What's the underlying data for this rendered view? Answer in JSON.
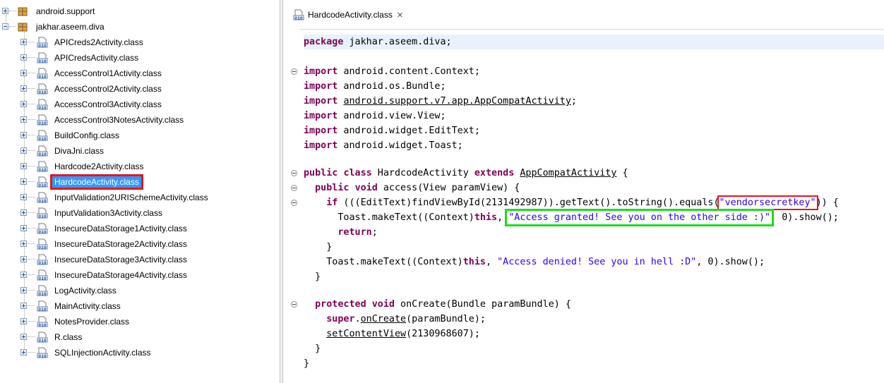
{
  "tree": {
    "packages": [
      {
        "label": "android.support",
        "expanded": false
      },
      {
        "label": "jakhar.aseem.diva",
        "expanded": true
      }
    ],
    "classes": [
      "APICreds2Activity.class",
      "APICredsActivity.class",
      "AccessControl1Activity.class",
      "AccessControl2Activity.class",
      "AccessControl3Activity.class",
      "AccessControl3NotesActivity.class",
      "BuildConfig.class",
      "DivaJni.class",
      "Hardcode2Activity.class",
      "HardcodeActivity.class",
      "InputValidation2URISchemeActivity.class",
      "InputValidation3Activity.class",
      "InsecureDataStorage1Activity.class",
      "InsecureDataStorage2Activity.class",
      "InsecureDataStorage3Activity.class",
      "InsecureDataStorage4Activity.class",
      "LogActivity.class",
      "MainActivity.class",
      "NotesProvider.class",
      "R.class",
      "SQLInjectionActivity.class"
    ],
    "selected_index": 9
  },
  "editor": {
    "tab_label": "HardcodeActivity.class",
    "tab_close": "✕",
    "code": {
      "l1_kw": "package",
      "l1_rest": " jakhar.aseem.diva;",
      "import_kw": "import",
      "imp1": " android.content.Context;",
      "imp2": " android.os.Bundle;",
      "imp3": "android.support.v7.app.AppCompatActivity",
      "imp3_end": ";",
      "imp4": " android.view.View;",
      "imp5": " android.widget.EditText;",
      "imp6": " android.widget.Toast;",
      "cls_public": "public",
      "cls_class": "class",
      "cls_name": " HardcodeActivity ",
      "cls_extends": "extends",
      "cls_parent": "AppCompatActivity",
      "cls_brace": " {",
      "m1_public": "public",
      "m1_void": "void",
      "m1_rest": " access(View paramView) {",
      "if_kw": "if",
      "if_rest": " (((EditText)findViewById(2131492987)).getText().toString().equals(",
      "if_str": "\"vendorsecretkey\"",
      "if_end": ")) {",
      "toast1_a": "Toast.makeText((Context)",
      "this_kw": "this",
      "toast1_b": ", ",
      "toast1_str": "\"Access granted! See you on the other side :)\"",
      "toast1_c": ", 0).show();",
      "return_kw": "return",
      "return_end": ";",
      "close_brace": "}",
      "toast2_a": "Toast.makeText((Context)",
      "toast2_b": ", ",
      "toast2_str": "\"Access denied! See you in hell :D\"",
      "toast2_c": ", 0).show();",
      "m2_protected": "protected",
      "m2_void": "void",
      "m2_rest": " onCreate(Bundle paramBundle) {",
      "super_kw": "super",
      "super_dot": ".",
      "super_call": "onCreate",
      "super_rest": "(paramBundle);",
      "setcv": "setContentView",
      "setcv_rest": "(2130968607);"
    }
  }
}
